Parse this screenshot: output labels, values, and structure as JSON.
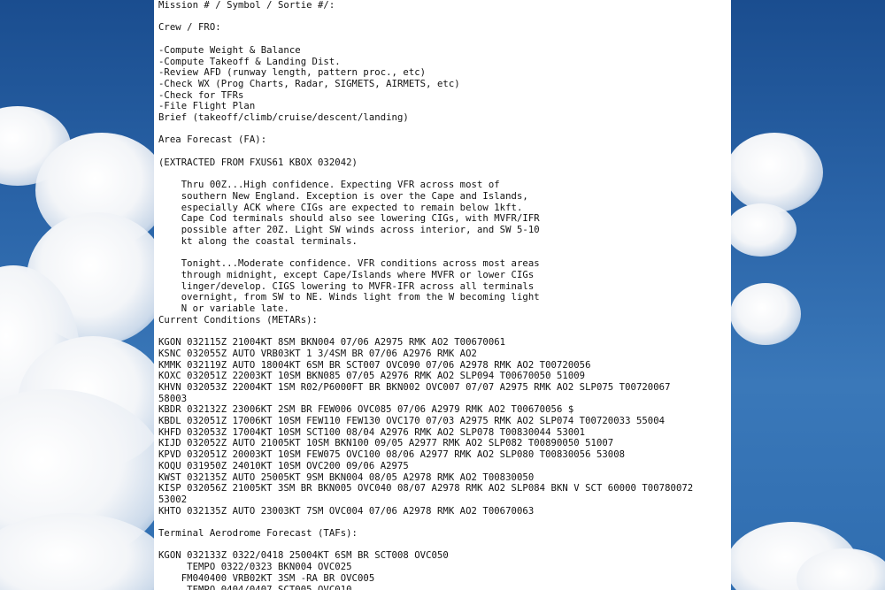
{
  "document": {
    "lines": [
      "Mission # / Symbol / Sortie #/:",
      "",
      "Crew / FRO:",
      "",
      "-Compute Weight & Balance",
      "-Compute Takeoff & Landing Dist.",
      "-Review AFD (runway length, pattern proc., etc)",
      "-Check WX (Prog Charts, Radar, SIGMETS, AIRMETS, etc)",
      "-Check for TFRs",
      "-File Flight Plan",
      "Brief (takeoff/climb/cruise/descent/landing)",
      "",
      "Area Forecast (FA):",
      "",
      "(EXTRACTED FROM FXUS61 KBOX 032042)",
      "",
      "    Thru 00Z...High confidence. Expecting VFR across most of",
      "    southern New England. Exception is over the Cape and Islands,",
      "    especially ACK where CIGs are expected to remain below 1kft.",
      "    Cape Cod terminals should also see lowering CIGs, with MVFR/IFR",
      "    possible after 20Z. Light SW winds across interior, and SW 5-10",
      "    kt along the coastal terminals.",
      "",
      "    Tonight...Moderate confidence. VFR conditions across most areas",
      "    through midnight, except Cape/Islands where MVFR or lower CIGs",
      "    linger/develop. CIGS lowering to MVFR-IFR across all terminals",
      "    overnight, from SW to NE. Winds light from the W becoming light",
      "    N or variable late.",
      "Current Conditions (METARs):",
      "",
      "KGON 032115Z 21004KT 8SM BKN004 07/06 A2975 RMK AO2 T00670061",
      "KSNC 032055Z AUTO VRB03KT 1 3/4SM BR 07/06 A2976 RMK AO2",
      "KMMK 032119Z AUTO 18004KT 6SM BR SCT007 OVC090 07/06 A2978 RMK AO2 T00720056",
      "KOXC 032051Z 22003KT 10SM BKN085 07/05 A2976 RMK AO2 SLP094 T00670050 51009",
      "KHVN 032053Z 22004KT 1SM R02/P6000FT BR BKN002 OVC007 07/07 A2975 RMK AO2 SLP075 T00720067",
      "58003",
      "KBDR 032132Z 23006KT 2SM BR FEW006 OVC085 07/06 A2979 RMK AO2 T00670056 $",
      "KBDL 032051Z 17006KT 10SM FEW110 FEW130 OVC170 07/03 A2975 RMK AO2 SLP074 T00720033 55004",
      "KHFD 032053Z 17004KT 10SM SCT100 08/04 A2976 RMK AO2 SLP078 T00830044 53001",
      "KIJD 032052Z AUTO 21005KT 10SM BKN100 09/05 A2977 RMK AO2 SLP082 T00890050 51007",
      "KPVD 032051Z 20003KT 10SM FEW075 OVC100 08/06 A2977 RMK AO2 SLP080 T00830056 53008",
      "KOQU 031950Z 24010KT 10SM OVC200 09/06 A2975",
      "KWST 032135Z AUTO 25005KT 9SM BKN004 08/05 A2978 RMK AO2 T00830050",
      "KISP 032056Z 21005KT 3SM BR BKN005 OVC040 08/07 A2978 RMK AO2 SLP084 BKN V SCT 60000 T00780072",
      "53002",
      "KHTO 032135Z AUTO 23003KT 7SM OVC004 07/06 A2978 RMK AO2 T00670063",
      "",
      "Terminal Aerodrome Forecast (TAFs):",
      "",
      "KGON 032133Z 0322/0418 25004KT 6SM BR SCT008 OVC050",
      "     TEMPO 0322/0323 BKN004 OVC025",
      "    FM040400 VRB02KT 3SM -RA BR OVC005",
      "     TEMPO 0404/0407 SCT005 OVC010"
    ]
  }
}
